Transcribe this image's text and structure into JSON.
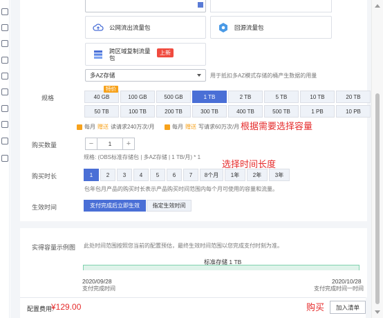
{
  "packages": {
    "public_outbound": "公网流出流量包",
    "origin_pull": "回源流量包",
    "cross_region_line1": "跨区域复制流量",
    "cross_region_line2": "包",
    "new_badge": "上新"
  },
  "storage_type": {
    "selected": "多AZ存储",
    "hint": "用于抵扣多AZ模式存储的桶产生数据的用量"
  },
  "spec": {
    "label": "规格",
    "special_badge": "特价",
    "row1": [
      "40 GB",
      "100 GB",
      "500 GB",
      "1 TB",
      "2 TB",
      "5 TB",
      "10 TB",
      "20 TB"
    ],
    "row2": [
      "50 TB",
      "100 TB",
      "200 TB",
      "300 TB",
      "400 TB",
      "500 TB",
      "1 PB",
      "10 PB"
    ],
    "selected": "1 TB",
    "promo1_pre": "每月",
    "promo1_hl": "赠送",
    "promo1_post": "读请求240万次/月",
    "promo2_pre": "每月",
    "promo2_hl": "赠送",
    "promo2_post": "写请求60万次/月",
    "annotation": "根据需要选择容量"
  },
  "quantity": {
    "label": "购买数量",
    "minus": "−",
    "value": "1",
    "plus": "+",
    "spec_text": "规格: (OBS标准存储包 | 多AZ存储 | 1 TB/月) * 1"
  },
  "duration": {
    "label": "购买时长",
    "annotation": "选择时间长度",
    "options": [
      "1",
      "2",
      "3",
      "4",
      "5",
      "6",
      "7",
      "8个月",
      "1年",
      "2年",
      "3年"
    ],
    "selected": "1",
    "note": "包年包月产品的购买时长表示产品购买时间范围内每个月可使用的容量和流量。"
  },
  "effective": {
    "label": "生效时间",
    "option_immediate": "支付完成后立即生效",
    "option_specified": "指定生效时间"
  },
  "example": {
    "label": "实得容量示例图",
    "desc": "此处时间范围按照您当前的配置预估，最终生效时间范围以您完成支付时刻为准。",
    "bar_label": "标准存储 1 TB",
    "start_date": "2020/09/28",
    "start_caption": "支付完成时间",
    "end_date": "2020/10/28",
    "end_caption": "支付完成时间一时间"
  },
  "footer": {
    "price_label": "配置费用:",
    "price": "¥129.00",
    "buy_note": "购买",
    "add_to_cart": "加入清单"
  },
  "colors": {
    "accent": "#4a6fd6",
    "annotation_red": "#e52b2b",
    "promo_orange": "#f7a21b",
    "timeline_green": "#7fd1ae"
  }
}
